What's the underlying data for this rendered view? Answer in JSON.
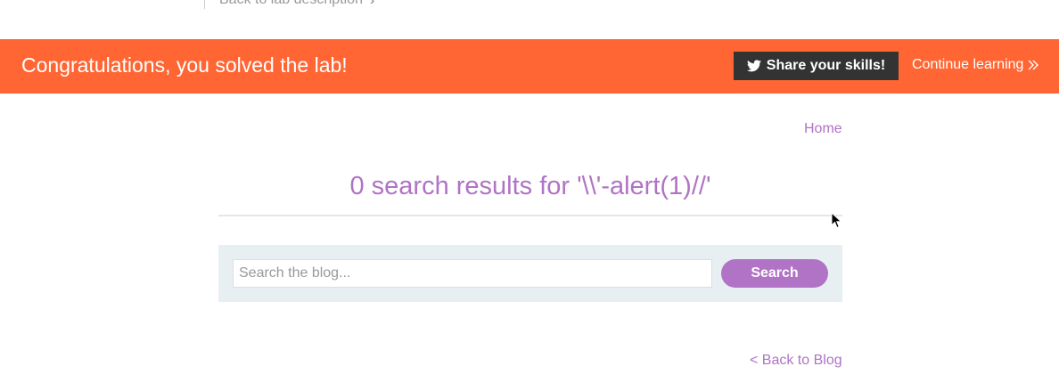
{
  "top": {
    "back_to_lab_label": "Back to lab description"
  },
  "banner": {
    "title": "Congratulations, you solved the lab!",
    "share_label": "Share your skills!",
    "continue_label": "Continue learning",
    "background_color": "#ff6633",
    "share_icon": "twitter-icon"
  },
  "nav": {
    "home_label": "Home"
  },
  "results": {
    "heading": "0 search results for '\\\\'-alert(1)//'"
  },
  "search": {
    "placeholder": "Search the blog...",
    "value": "",
    "button_label": "Search",
    "accent_color": "#b073c5"
  },
  "footer": {
    "back_to_blog_label": "< Back to Blog"
  }
}
